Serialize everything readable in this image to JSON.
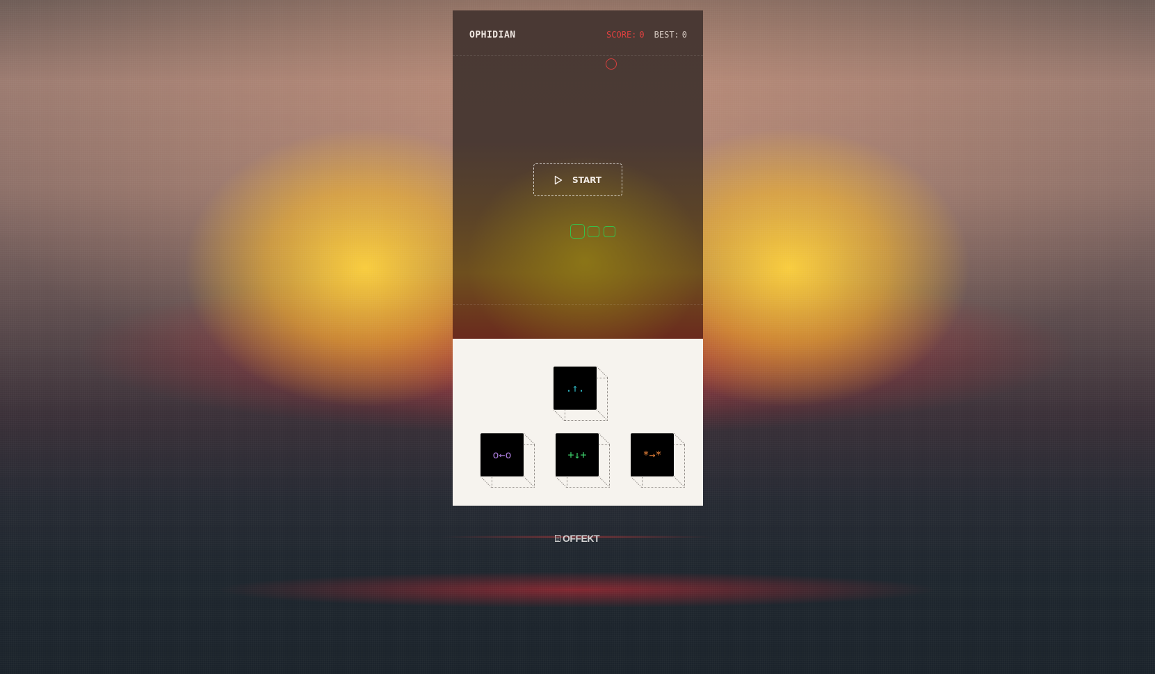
{
  "game": {
    "title": "OPHIDIAN",
    "score_label": "SCORE:",
    "score_value": "0",
    "best_label": "BEST:",
    "best_value": "0",
    "start_label": "START",
    "colors": {
      "score": "#e0403f",
      "snake": "#35c24c",
      "food": "#d9403e"
    }
  },
  "controls": {
    "up": {
      "glyph": ".↑.",
      "color": "#2fb9c6"
    },
    "left": {
      "glyph": "o←o",
      "color": "#a77ad6"
    },
    "down": {
      "glyph": "+↓+",
      "color": "#3ccf6a"
    },
    "right": {
      "glyph": "*→*",
      "color": "#e8823a"
    }
  },
  "footer": {
    "brand": "OFFEKT"
  }
}
